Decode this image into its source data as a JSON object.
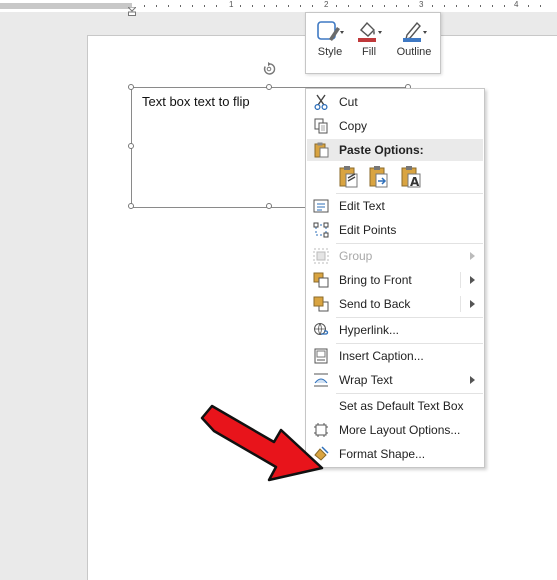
{
  "ruler": {
    "numbers": [
      "1",
      "2",
      "3",
      "4"
    ]
  },
  "document": {
    "textbox_text": "Text box text to flip"
  },
  "mini_toolbar": {
    "buttons": [
      {
        "label": "Style",
        "icon": "shape-style-icon"
      },
      {
        "label": "Fill",
        "icon": "paint-bucket-icon",
        "color": "#c0393b"
      },
      {
        "label": "Outline",
        "icon": "pen-outline-icon",
        "color": "#3f79c3"
      }
    ]
  },
  "context_menu": {
    "items": [
      {
        "label": "Cut",
        "icon": "scissors-icon",
        "enabled": true
      },
      {
        "label": "Copy",
        "icon": "copy-icon",
        "enabled": true
      },
      {
        "label": "Paste Options:",
        "icon": "clipboard-icon",
        "enabled": true
      },
      {
        "label": "Edit Text",
        "icon": "edit-text-icon",
        "enabled": true
      },
      {
        "label": "Edit Points",
        "icon": "edit-points-icon",
        "enabled": true
      },
      {
        "label": "Group",
        "icon": "group-icon",
        "enabled": false,
        "submenu": true
      },
      {
        "label": "Bring to Front",
        "icon": "bring-front-icon",
        "enabled": true,
        "submenu": true
      },
      {
        "label": "Send to Back",
        "icon": "send-back-icon",
        "enabled": true,
        "submenu": true
      },
      {
        "label": "Hyperlink...",
        "icon": "hyperlink-icon",
        "enabled": true
      },
      {
        "label": "Insert Caption...",
        "icon": "caption-icon",
        "enabled": true
      },
      {
        "label": "Wrap Text",
        "icon": "wrap-text-icon",
        "enabled": true,
        "submenu": true
      },
      {
        "label": "Set as Default Text Box",
        "icon": "",
        "enabled": true
      },
      {
        "label": "More Layout Options...",
        "icon": "layout-options-icon",
        "enabled": true
      },
      {
        "label": "Format Shape...",
        "icon": "format-shape-icon",
        "enabled": true
      }
    ],
    "paste_icons": [
      "paste-keep-source-icon",
      "paste-merge-icon",
      "paste-text-only-icon"
    ]
  },
  "annotation": {
    "arrow_color": "#e8141b"
  }
}
